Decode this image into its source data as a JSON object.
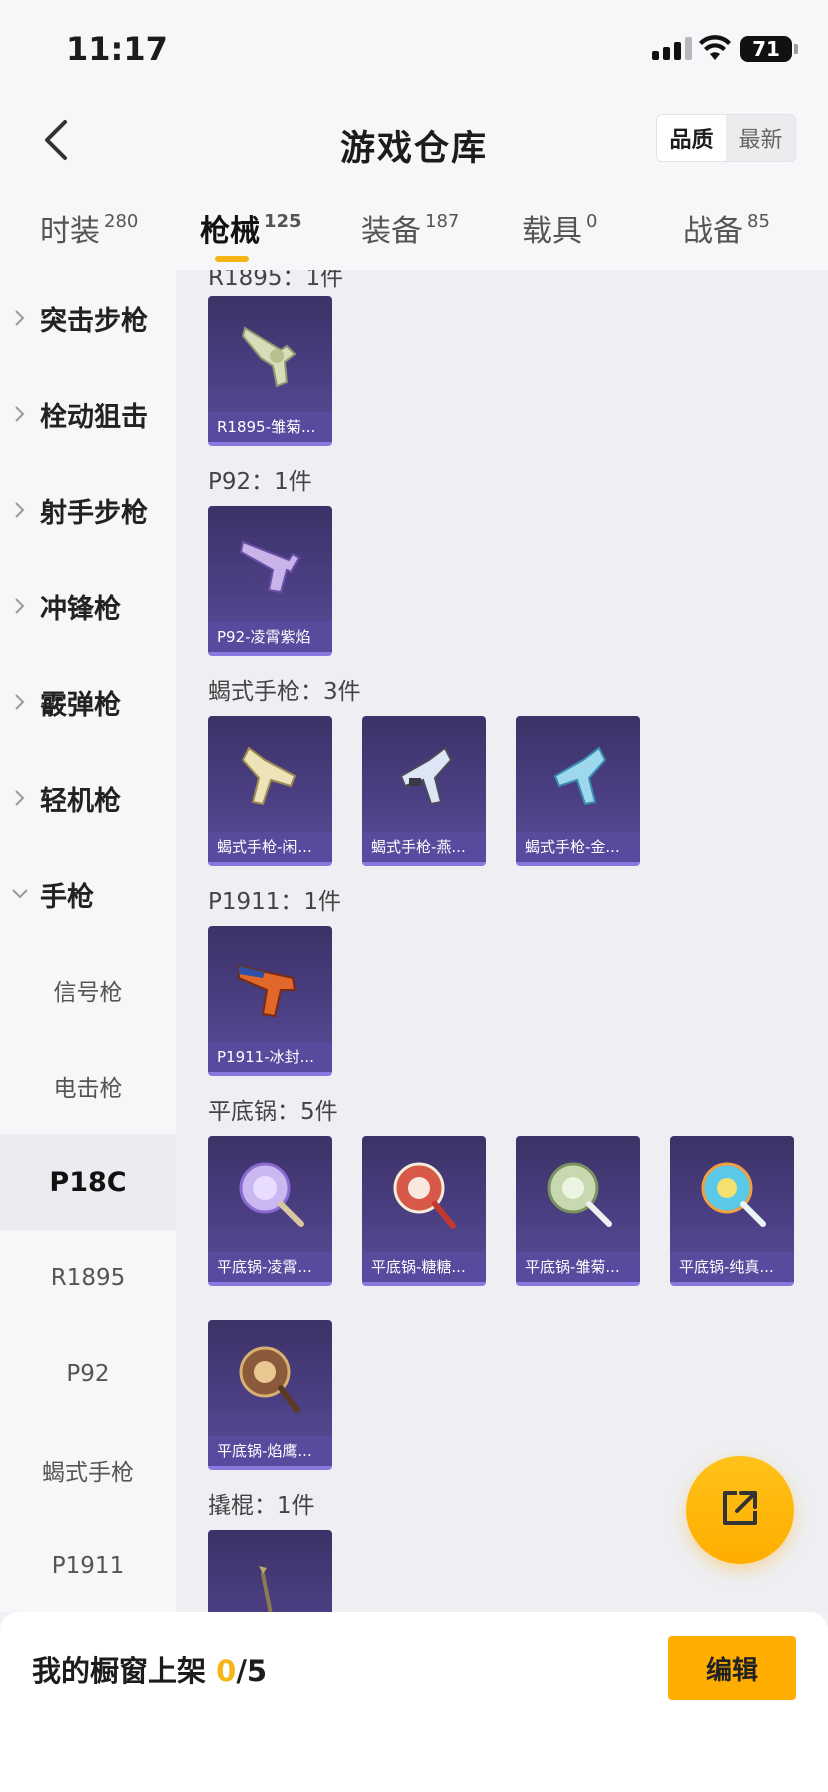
{
  "status_bar": {
    "time": "11:17",
    "battery": "71"
  },
  "header": {
    "title": "游戏仓库",
    "back_icon": "chevron-left-icon",
    "sort_options": [
      "品质",
      "最新"
    ],
    "sort_active": "品质"
  },
  "tabs": [
    {
      "label": "时装",
      "count": "280"
    },
    {
      "label": "枪械",
      "count": "125"
    },
    {
      "label": "装备",
      "count": "187"
    },
    {
      "label": "载具",
      "count": "0"
    },
    {
      "label": "战备",
      "count": "85"
    }
  ],
  "active_tab": "枪械",
  "sidebar": {
    "categories": [
      "突击步枪",
      "栓动狙击",
      "射手步枪",
      "冲锋枪",
      "霰弹枪",
      "轻机枪",
      "手枪"
    ],
    "expanded": "手枪",
    "subitems": [
      "信号枪",
      "电击枪",
      "P18C",
      "R1895",
      "P92",
      "蝎式手枪",
      "P1911"
    ],
    "selected_sub": "P18C"
  },
  "groups": [
    {
      "title": "R1895：1件",
      "items": [
        "R1895-雏菊..."
      ]
    },
    {
      "title": "P92：1件",
      "items": [
        "P92-凌霄紫焰"
      ]
    },
    {
      "title": "蝎式手枪：3件",
      "items": [
        "蝎式手枪-闲...",
        "蝎式手枪-燕...",
        "蝎式手枪-金..."
      ]
    },
    {
      "title": "P1911：1件",
      "items": [
        "P1911-冰封..."
      ]
    },
    {
      "title": "平底锅：5件",
      "items": [
        "平底锅-凌霄...",
        "平底锅-糖糖...",
        "平底锅-雏菊...",
        "平底锅-纯真...",
        "平底锅-焰鹰..."
      ]
    },
    {
      "title": "撬棍：1件",
      "items": []
    }
  ],
  "bottom_bar": {
    "label": "我的橱窗上架",
    "count": "0",
    "total": "/5",
    "edit_label": "编辑"
  },
  "fab_icon": "share-external-icon",
  "colors": {
    "accent": "#ffad00",
    "indicator": "#f5b515",
    "card_bg": "#4b3f83"
  }
}
